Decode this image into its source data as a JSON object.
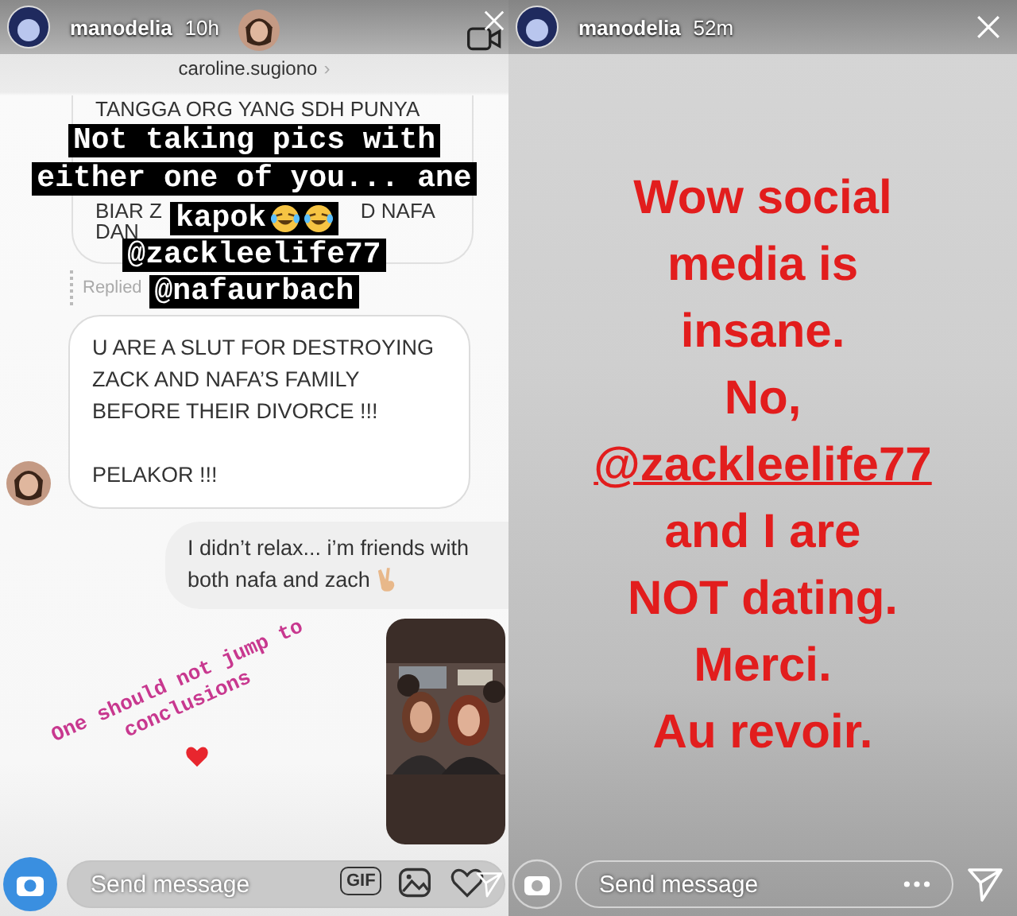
{
  "left_story": {
    "user": "manodelia",
    "time": "10h",
    "thread_user": "caroline.sugiono",
    "thread_chevron": "›",
    "quoted_lines": [
      [
        "TANGGA ORG YANG SDH PUNYA"
      ],
      [
        "BIAR Z",
        "D NAFA"
      ],
      [
        "DAN"
      ]
    ],
    "replied_label": "Replied",
    "messages": [
      {
        "kind": "incoming",
        "paragraphs": [
          [
            "U ARE A SLUT FOR DESTROYING",
            "ZACK AND NAFA’S FAMILY",
            "BEFORE THEIR DIVORCE !!!"
          ],
          [
            "PELAKOR !!!"
          ]
        ]
      },
      {
        "kind": "outgoing",
        "paragraphs": [
          [
            "I didn’t relax... i’m friends with",
            "both nafa and zach"
          ]
        ]
      },
      {
        "kind": "story"
      }
    ],
    "stickers": [
      {
        "text": "Not taking pics with",
        "kind": "plain"
      },
      {
        "text": "either one of you... ane",
        "kind": "plain"
      },
      {
        "text": "kapok",
        "kind": "laughing"
      },
      {
        "text": "@zackleelife77",
        "kind": "plain"
      },
      {
        "text": "@nafaurbach",
        "kind": "plain"
      }
    ],
    "caption": {
      "lines": [
        "One should not jump to",
        "conclusions"
      ],
      "heart": true
    },
    "composer": {
      "placeholder": "Send message",
      "gif_label": "GIF"
    }
  },
  "right_story": {
    "user": "manodelia",
    "time": "52m",
    "lines": [
      {
        "text": "Wow social",
        "kind": "plain"
      },
      {
        "text": "media is",
        "kind": "plain"
      },
      {
        "text": "insane.",
        "kind": "plain"
      },
      {
        "text": "No,",
        "kind": "plain"
      },
      {
        "text": "@zackleelife77",
        "kind": "mention"
      },
      {
        "text": "and I are",
        "kind": "plain"
      },
      {
        "text": "NOT dating.",
        "kind": "plain"
      },
      {
        "text": "Merci.",
        "kind": "plain"
      },
      {
        "text": "Au revoir.",
        "kind": "plain"
      }
    ],
    "composer": {
      "placeholder": "Send message"
    }
  }
}
